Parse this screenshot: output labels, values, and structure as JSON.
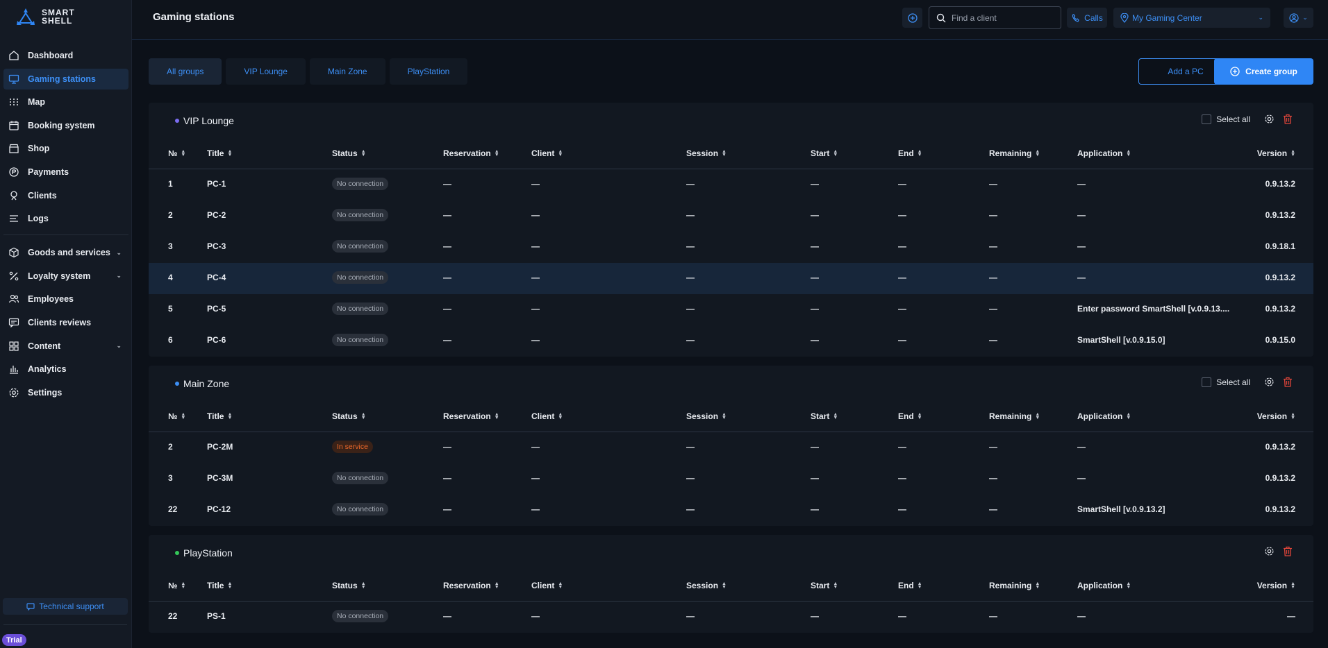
{
  "brand": {
    "line1": "SMART",
    "line2": "SHELL"
  },
  "nav": [
    {
      "label": "Dashboard",
      "icon": "home-icon"
    },
    {
      "label": "Gaming stations",
      "icon": "monitor-icon",
      "active": true
    },
    {
      "label": "Map",
      "icon": "grid-dots-icon"
    },
    {
      "label": "Booking system",
      "icon": "calendar-icon"
    },
    {
      "label": "Shop",
      "icon": "store-icon"
    },
    {
      "label": "Payments",
      "icon": "coin-icon"
    },
    {
      "label": "Clients",
      "icon": "user-icon"
    },
    {
      "label": "Logs",
      "icon": "list-icon"
    }
  ],
  "nav2": [
    {
      "label": "Goods and services",
      "icon": "box-icon",
      "caret": true
    },
    {
      "label": "Loyalty system",
      "icon": "percent-icon",
      "caret": true
    },
    {
      "label": "Employees",
      "icon": "users-icon"
    },
    {
      "label": "Clients reviews",
      "icon": "chat-icon"
    },
    {
      "label": "Content",
      "icon": "tiles-icon",
      "caret": true
    },
    {
      "label": "Analytics",
      "icon": "chart-icon"
    },
    {
      "label": "Settings",
      "icon": "gear-icon"
    }
  ],
  "support_label": "Technical support",
  "trial_label": "Trial",
  "header": {
    "title": "Gaming stations",
    "search_placeholder": "Find a client",
    "calls_label": "Calls",
    "center_label": "My Gaming Center"
  },
  "tabs": [
    "All groups",
    "VIP Lounge",
    "Main Zone",
    "PlayStation"
  ],
  "actions": {
    "add_pc": "Add a PC",
    "create_group": "Create group"
  },
  "columns": [
    "№",
    "Title",
    "Status",
    "Reservation",
    "Client",
    "Session",
    "Start",
    "End",
    "Remaining",
    "Application",
    "Version"
  ],
  "select_all": "Select all",
  "dash": "—",
  "groups": [
    {
      "name": "VIP Lounge",
      "dot_color": "#7b6cf0",
      "select_all": true,
      "rows": [
        {
          "num": "1",
          "title": "PC-1",
          "status": "No connection",
          "app": "—",
          "version": "0.9.13.2"
        },
        {
          "num": "2",
          "title": "PC-2",
          "status": "No connection",
          "app": "—",
          "version": "0.9.13.2"
        },
        {
          "num": "3",
          "title": "PC-3",
          "status": "No connection",
          "app": "—",
          "version": "0.9.18.1"
        },
        {
          "num": "4",
          "title": "PC-4",
          "status": "No connection",
          "app": "—",
          "version": "0.9.13.2",
          "highlight": true
        },
        {
          "num": "5",
          "title": "PC-5",
          "status": "No connection",
          "app": "Enter password SmartShell [v.0.9.13....",
          "version": "0.9.13.2"
        },
        {
          "num": "6",
          "title": "PC-6",
          "status": "No connection",
          "app": "SmartShell [v.0.9.15.0]",
          "version": "0.9.15.0"
        }
      ]
    },
    {
      "name": "Main Zone",
      "dot_color": "#3d8ff5",
      "select_all": true,
      "rows": [
        {
          "num": "2",
          "title": "PC-2M",
          "status": "In service",
          "service": true,
          "app": "—",
          "version": "0.9.13.2"
        },
        {
          "num": "3",
          "title": "PC-3M",
          "status": "No connection",
          "app": "—",
          "version": "0.9.13.2"
        },
        {
          "num": "22",
          "title": "PC-12",
          "status": "No connection",
          "app": "SmartShell [v.0.9.13.2]",
          "version": "0.9.13.2"
        }
      ]
    },
    {
      "name": "PlayStation",
      "dot_color": "#34c759",
      "select_all": false,
      "rows": [
        {
          "num": "22",
          "title": "PS-1",
          "status": "No connection",
          "app": "—",
          "version": "—"
        }
      ]
    }
  ]
}
